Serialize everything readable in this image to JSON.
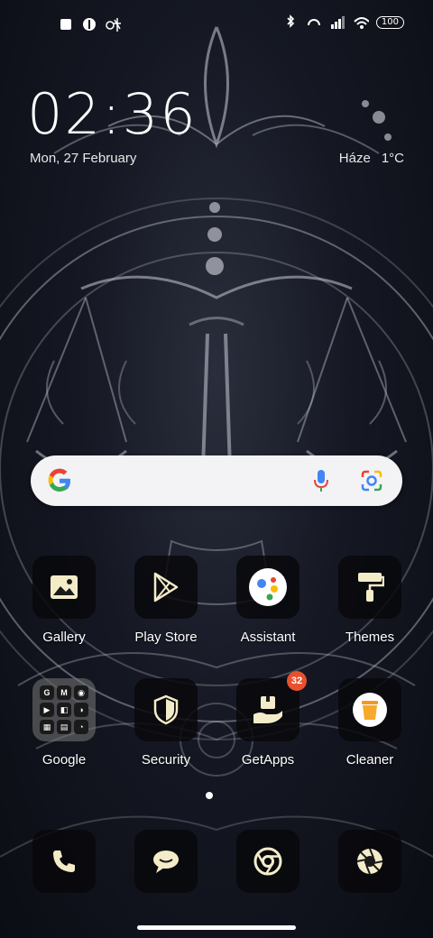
{
  "status": {
    "battery": "100",
    "icons_left": [
      "notification-square-icon",
      "app-notification-icon",
      "signal-tower-icon"
    ],
    "icons_right": [
      "bluetooth-icon",
      "data-saver-icon",
      "cell-signal-icon",
      "wifi-icon"
    ]
  },
  "clock": {
    "time": "02:36",
    "date": "Mon, 27 February"
  },
  "weather": {
    "location": "Háze",
    "temp": "1°C"
  },
  "search": {
    "logo": "G"
  },
  "apps_row1": [
    {
      "label": "Gallery",
      "icon": "gallery-icon"
    },
    {
      "label": "Play Store",
      "icon": "play-store-icon"
    },
    {
      "label": "Assistant",
      "icon": "assistant-icon"
    },
    {
      "label": "Themes",
      "icon": "paint-roller-icon"
    }
  ],
  "apps_row2": [
    {
      "label": "Google",
      "icon": "folder-icon"
    },
    {
      "label": "Security",
      "icon": "shield-icon"
    },
    {
      "label": "GetApps",
      "icon": "getapps-icon",
      "badge": "32"
    },
    {
      "label": "Cleaner",
      "icon": "trash-icon"
    }
  ],
  "folder_items": [
    "G",
    "M",
    "◉",
    "▶",
    "◧",
    "◑",
    "▦",
    "▤",
    "◔"
  ],
  "dock": [
    {
      "icon": "phone-icon"
    },
    {
      "icon": "messages-icon"
    },
    {
      "icon": "chrome-icon"
    },
    {
      "icon": "camera-aperture-icon"
    }
  ],
  "colors": {
    "accent_badge": "#e8502f",
    "search_bg": "#f3f3f5"
  }
}
